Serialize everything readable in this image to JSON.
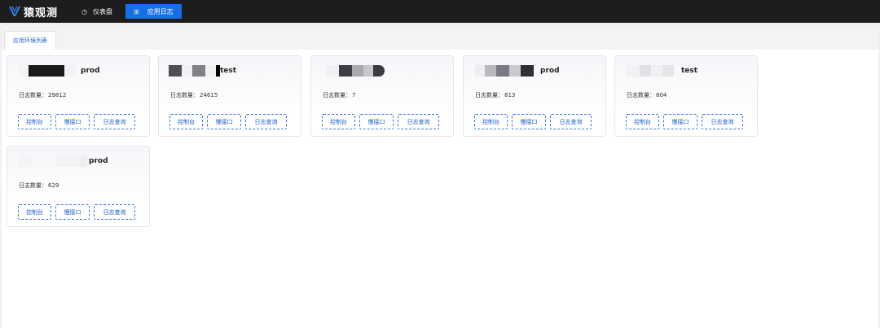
{
  "app": {
    "name": "猿观测"
  },
  "nav": {
    "items": [
      {
        "label": "仪表盘",
        "icon": "gauge-icon",
        "active": false
      },
      {
        "label": "应用日志",
        "icon": "grid-icon",
        "active": true
      }
    ]
  },
  "tabs": [
    {
      "label": "应用环境列表"
    }
  ],
  "cards": [
    {
      "env": "prod",
      "count_label": "日志数量：",
      "count": "29812"
    },
    {
      "env": "test",
      "count_label": "日志数量：",
      "count": "24615"
    },
    {
      "env": "",
      "count_label": "日志数量：",
      "count": "7"
    },
    {
      "env": "prod",
      "count_label": "日志数量：",
      "count": "813"
    },
    {
      "env": "test",
      "count_label": "日志数量：",
      "count": "804"
    },
    {
      "env": "prod",
      "count_label": "日志数量：",
      "count": "629"
    }
  ],
  "card_actions": {
    "console": "控制台",
    "slow_api": "慢接口",
    "log_query": "日志查询"
  },
  "colors": {
    "accent": "#1570e8",
    "topbar": "#1d1d1d",
    "button_text": "#1d5fc9"
  }
}
